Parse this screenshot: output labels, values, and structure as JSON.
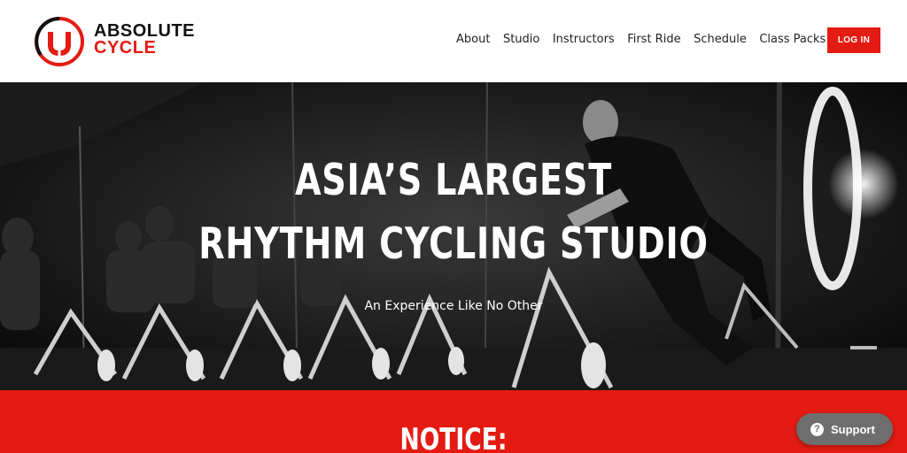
{
  "header": {
    "logo": {
      "line1": "ABSOLUTE",
      "line2": "CYCLE"
    },
    "nav": [
      "About",
      "Studio",
      "Instructors",
      "First Ride",
      "Schedule",
      "Class Packs"
    ],
    "login_label": "LOG IN"
  },
  "hero": {
    "title_line1": "ASIA’S LARGEST",
    "title_line2": "RHYTHM CYCLING STUDIO",
    "subtitle": "An Experience Like No Other"
  },
  "notice": {
    "title": "NOTICE:"
  },
  "support": {
    "label": "Support",
    "icon": "question-icon"
  },
  "colors": {
    "brand_red": "#e31b13",
    "text_dark": "#222222",
    "support_gray": "#6e6e6e"
  }
}
